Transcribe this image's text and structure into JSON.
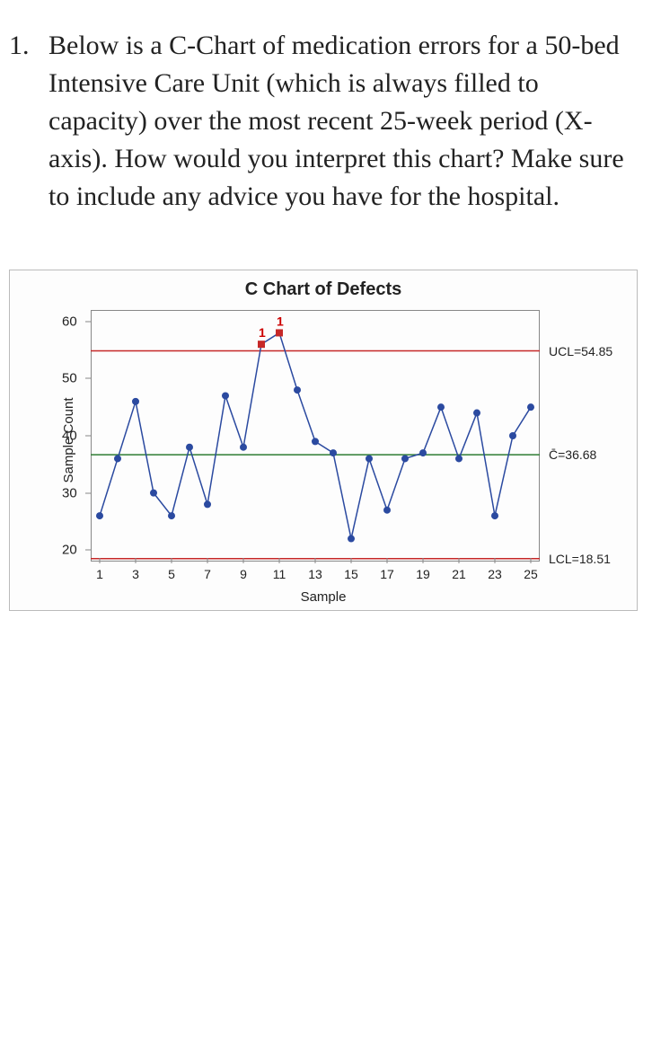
{
  "question": {
    "number": "1.",
    "text": "Below is a C-Chart of medication errors for a 50-bed Intensive Care Unit (which is always filled to capacity) over the most recent 25-week period (X-axis). How would you interpret this chart? Make sure to include any advice you have for the hospital."
  },
  "chart_data": {
    "type": "line",
    "title": "C Chart of Defects",
    "ylabel": "Sample Count",
    "xlabel": "Sample",
    "ylim": [
      18,
      62
    ],
    "yticks": [
      20,
      30,
      40,
      50,
      60
    ],
    "xticks": [
      1,
      3,
      5,
      7,
      9,
      11,
      13,
      15,
      17,
      19,
      21,
      23,
      25
    ],
    "x": [
      1,
      2,
      3,
      4,
      5,
      6,
      7,
      8,
      9,
      10,
      11,
      12,
      13,
      14,
      15,
      16,
      17,
      18,
      19,
      20,
      21,
      22,
      23,
      24,
      25
    ],
    "values": [
      26,
      36,
      46,
      30,
      26,
      38,
      28,
      47,
      38,
      56,
      58,
      48,
      39,
      37,
      22,
      36,
      27,
      36,
      37,
      45,
      36,
      44,
      26,
      40,
      45
    ],
    "ucl": 54.85,
    "center": 36.68,
    "lcl": 18.51,
    "ucl_label": "UCL=54.85",
    "center_label": "C̄=36.68",
    "lcl_label": "LCL=18.51",
    "outliers": [
      {
        "x": 10,
        "label": "1"
      },
      {
        "x": 11,
        "label": "1"
      }
    ]
  }
}
